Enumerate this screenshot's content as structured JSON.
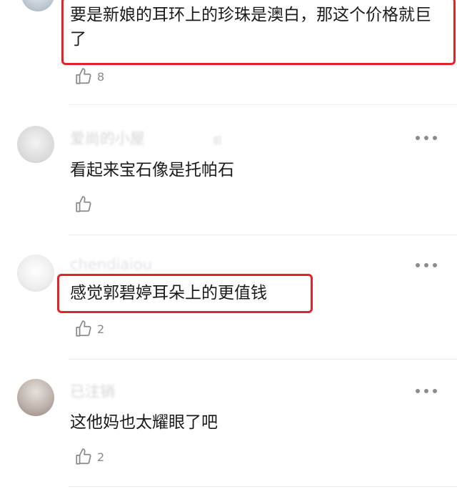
{
  "comments": [
    {
      "username": "",
      "timestamp": "",
      "content": "要是新娘的耳环上的珍珠是澳白，那这个价格就巨了",
      "likes": "8"
    },
    {
      "username": "爱尚的小屋",
      "timestamp": "前",
      "content": "看起来宝石像是托帕石",
      "likes": ""
    },
    {
      "username": "chendiaiou",
      "timestamp": "",
      "content": "感觉郭碧婷耳朵上的更值钱",
      "likes": "2"
    },
    {
      "username": "已注销",
      "timestamp": "",
      "content": "这他妈也太耀眼了吧",
      "likes": "2"
    }
  ],
  "icons": {
    "like": "thumbs-up-icon",
    "more": "more-horizontal-icon"
  },
  "colors": {
    "highlight_box": "#e0242b",
    "like_icon": "#8a8a8a",
    "more_icon": "#8c8c8c"
  }
}
